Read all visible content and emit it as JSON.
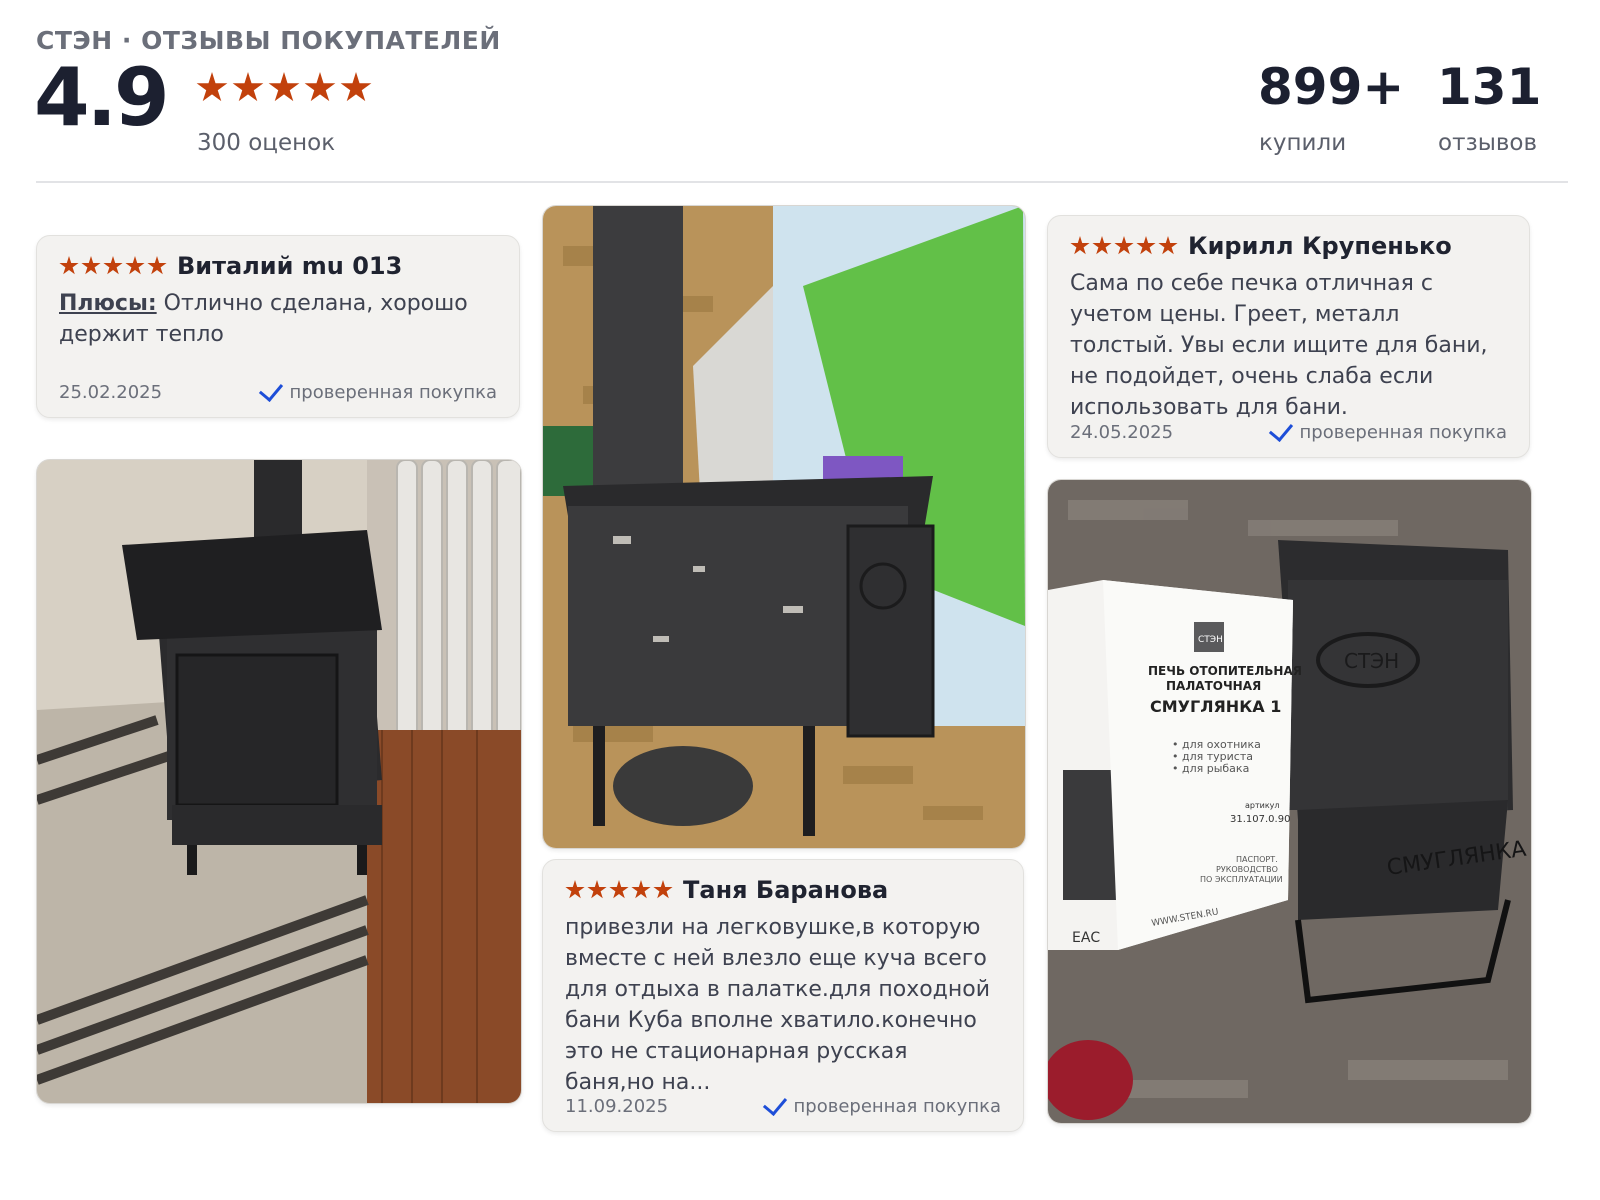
{
  "header": {
    "brand_line": "СТЭН · ОТЗЫВЫ ПОКУПАТЕЛЕЙ",
    "rating": "4.9",
    "stars": 5,
    "ratings_count": "300 оценок",
    "bought_value": "899+",
    "bought_label": "купили",
    "reviews_value": "131",
    "reviews_label": "отзывов"
  },
  "reviews": [
    {
      "author": "Виталий mu 013",
      "stars": 5,
      "pros_label": "Плюсы:",
      "text": " Отлично сделана, хорошо держит тепло",
      "date": "25.02.2025",
      "verified": "проверенная покупка"
    },
    {
      "author": "Таня Баранова",
      "stars": 5,
      "text": "привезли на легковушке,в которую вместе с ней влезло еще куча всего для отдыха в палатке.для походной бани Куба вполне хватило.конечно это не стационарная русская баня,но на...",
      "date": "11.09.2025",
      "verified": "проверенная покупка"
    },
    {
      "author": "Кирилл Крупенько",
      "stars": 5,
      "text": "Сама по себе печка отличная с учетом цены. Греет, металл толстый. Увы если ищите для бани, не подойдет, очень слаба если использовать для бани.",
      "date": "24.05.2025",
      "verified": "проверенная покупка"
    }
  ],
  "booklet": {
    "logo": "СТЭН",
    "title_line1": "ПЕЧЬ ОТОПИТЕЛЬНАЯ",
    "title_line2": "ПАЛАТОЧНАЯ",
    "model": "СМУГЛЯНКА 1",
    "bullet1": "• для охотника",
    "bullet2": "• для туриста",
    "bullet3": "• для рыбака",
    "article_label": "артикул",
    "article": "31.107.0.90",
    "passport1": "ПАСПОРТ.",
    "passport2": "РУКОВОДСТВО",
    "passport3": "ПО ЭКСПЛУАТАЦИИ",
    "site": "WWW.STEN.RU",
    "eac": "ЕАС"
  },
  "stove_labels": {
    "door_logo": "СТЭН",
    "front_label": "СМУГЛЯНКА"
  },
  "colors": {
    "star": "#c2410c",
    "check": "#1d4ed8",
    "card_bg": "#f3f2f0"
  }
}
